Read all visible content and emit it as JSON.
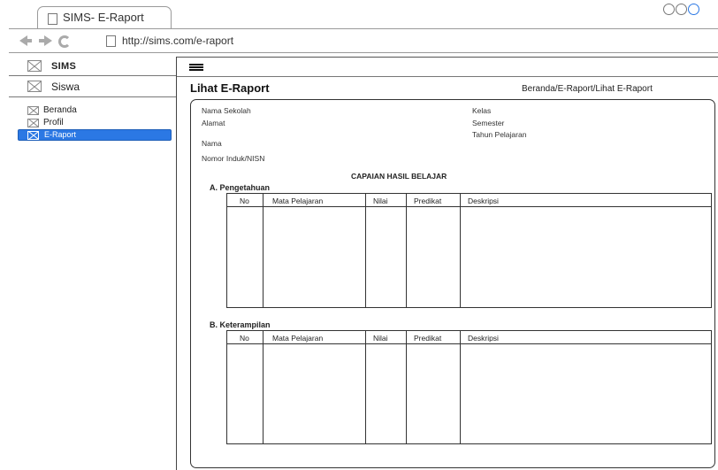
{
  "browser": {
    "tab_title": "SIMS- E-Raport",
    "url": "http://sims.com/e-raport"
  },
  "sidebar": {
    "brand": "SIMS",
    "section": "Siswa",
    "menu": [
      {
        "label": "Beranda",
        "active": false
      },
      {
        "label": "Profil",
        "active": false
      },
      {
        "label": "E-Raport",
        "active": true
      }
    ]
  },
  "header": {
    "title": "Lihat E-Raport",
    "breadcrumb": "Beranda/E-Raport/Lihat E-Raport"
  },
  "info": {
    "nama_sekolah": "Nama Sekolah",
    "alamat": "Alamat",
    "nama": "Nama",
    "nisn": "Nomor Induk/NISN",
    "kelas": "Kelas",
    "semester": "Semester",
    "tahun": "Tahun Pelajaran"
  },
  "capaian": {
    "title": "CAPAIAN HASIL BELAJAR",
    "pengetahuan": "A. Pengetahuan",
    "keterampilan": "B. Keterampilan"
  },
  "table_columns": [
    "No",
    "Mata Pelajaran",
    "Nilai",
    "Predikat",
    "Deskripsi"
  ],
  "colors": {
    "accent": "#2b78e4",
    "border": "#333333"
  }
}
